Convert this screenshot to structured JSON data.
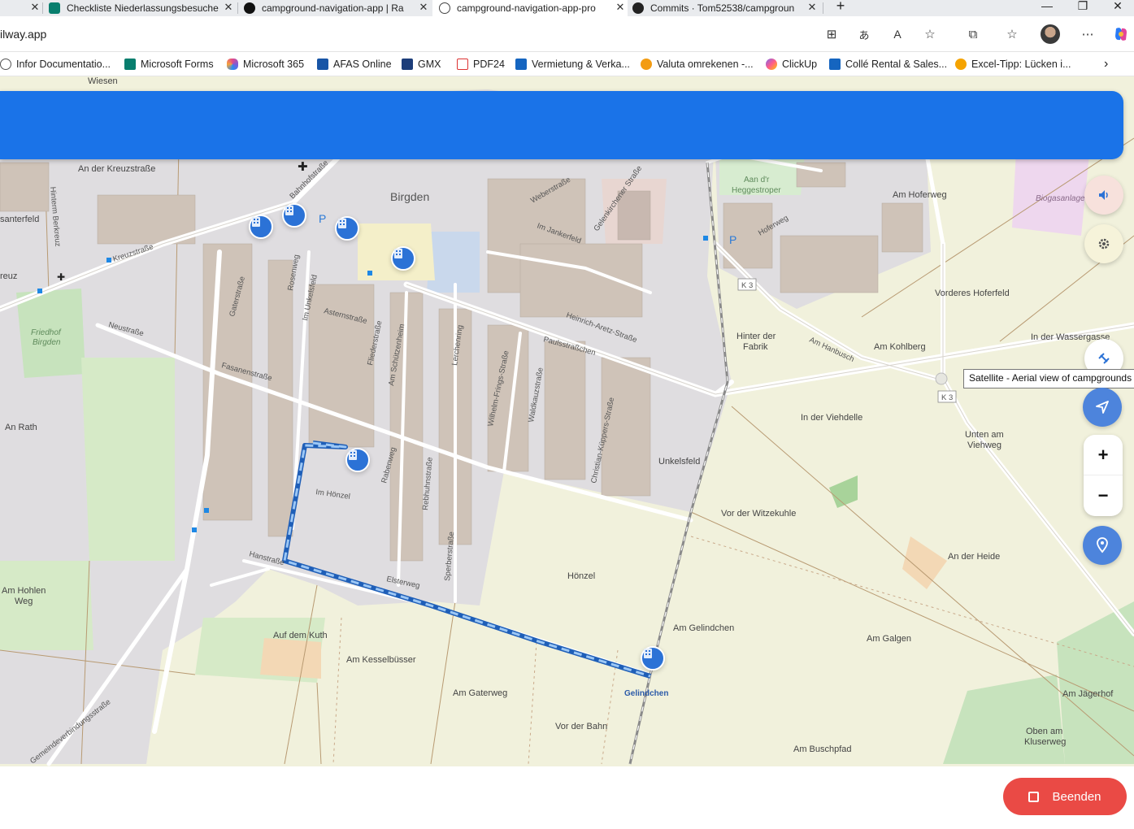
{
  "browser": {
    "tabs": [
      {
        "title": "",
        "active": false
      },
      {
        "title": "Checkliste Niederlassungsbesuche",
        "active": false
      },
      {
        "title": "campground-navigation-app | Ra",
        "active": false
      },
      {
        "title": "campground-navigation-app-pro",
        "active": true
      },
      {
        "title": "Commits · Tom52538/campgroun",
        "active": false
      }
    ],
    "url": "ilway.app",
    "bookmarks": [
      "Infor Documentatio...",
      "Microsoft Forms",
      "Microsoft 365",
      "AFAS Online",
      "GMX",
      "PDF24",
      "Vermietung & Verka...",
      "Valuta omrekenen -...",
      "ClickUp",
      "Collé Rental & Sales...",
      "Excel-Tipp: Lücken i..."
    ]
  },
  "map": {
    "place_labels": [
      "Wiesen",
      "An der Kreuzstraße",
      "Birgden",
      "Aan d'r Heggestroper",
      "Am Hoferweg",
      "Biogasanlage",
      "Vorderes Hoferfeld",
      "In der Wassergasse",
      "Am Kohlberg",
      "Hinter der Fabrik",
      "In der Viehdelle",
      "Unten am Viehweg",
      "Unkelsfeld",
      "Vor der Witzekuhle",
      "An der Heide",
      "Hönzel",
      "Am Gelindchen",
      "Am Galgen",
      "Am Kesselbüsser",
      "Am Gaterweg",
      "Vor der Bahn",
      "Am Buschpfad",
      "Am Jägerhof",
      "Oben am Kluserweg",
      "Auf dem Kuth",
      "Am Hohlen Weg",
      "An Rath",
      "Friedhof Birgden",
      "santerfeld",
      "reuz",
      "Gelindchen"
    ],
    "street_labels": [
      "Kreuzstraße",
      "Bahnhofstraße",
      "Neustraße",
      "Gaterstraße",
      "Rosenweg",
      "Im Unkelsfeld",
      "Asternstraße",
      "Fliederstraße",
      "Am Schützenheim",
      "Fasanenstraße",
      "Im Hönzel",
      "Rabenweg",
      "Rebhuhnstraße",
      "Sperberstraße",
      "Elsterweg",
      "Hanstraße",
      "Lerchenring",
      "Wilhelm-Frings-Straße",
      "Waldkauzstraße",
      "Christian-Küppers-Straße",
      "Paulsstraßchen",
      "Heinrich-Aretz-Straße",
      "Im Jankerfeld",
      "Weberstraße",
      "Gelenkirchener Straße",
      "Hoferweg",
      "Am Hanbusch",
      "Hinterm Berkreuz",
      "Gemeindeverbindungsstraße"
    ],
    "road_refs": [
      "K 3",
      "K 3"
    ]
  },
  "controls": {
    "sound_icon": "volume-icon",
    "settings_icon": "gear-icon",
    "satellite_icon": "satellite-icon",
    "navigate_icon": "navigation-arrow-icon",
    "zoom_in": "+",
    "zoom_out": "−",
    "location_icon": "location-pin-icon",
    "satellite_tooltip": "Satellite - Aerial view of campgrounds"
  },
  "footer": {
    "end_button": "Beenden"
  },
  "colors": {
    "banner": "#1a73e8",
    "route": "#2f7de0",
    "end_button": "#ea4a45",
    "marker": "#2b72d6"
  }
}
